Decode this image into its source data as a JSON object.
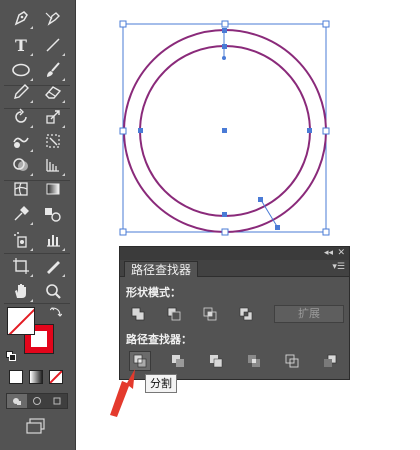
{
  "toolbar": {
    "tools": [
      {
        "icon": "pen-icon"
      },
      {
        "icon": "anchor-point-icon"
      },
      {
        "icon": "type-icon",
        "label": "T"
      },
      {
        "icon": "line-segment-icon"
      },
      {
        "icon": "ellipse-icon"
      },
      {
        "icon": "paintbrush-icon"
      },
      {
        "icon": "pencil-icon"
      },
      {
        "icon": "eraser-icon"
      },
      {
        "icon": "rotate-icon"
      },
      {
        "icon": "scale-icon"
      },
      {
        "icon": "warp-icon"
      },
      {
        "icon": "free-transform-icon"
      },
      {
        "icon": "shape-builder-icon"
      },
      {
        "icon": "perspective-grid-icon"
      },
      {
        "icon": "mesh-icon"
      },
      {
        "icon": "gradient-icon"
      },
      {
        "icon": "eyedropper-icon"
      },
      {
        "icon": "blend-icon"
      },
      {
        "icon": "symbol-sprayer-icon"
      },
      {
        "icon": "column-graph-icon"
      },
      {
        "icon": "artboard-icon"
      },
      {
        "icon": "slice-icon"
      },
      {
        "icon": "hand-icon"
      },
      {
        "icon": "zoom-icon"
      }
    ],
    "colors": {
      "fill": "none",
      "stroke": "#e3051b"
    }
  },
  "pathfinder": {
    "tab": "路径查找器",
    "shape_modes": {
      "label": "形状模式：",
      "buttons": [
        "unite-icon",
        "minus-front-icon",
        "intersect-icon",
        "exclude-icon"
      ],
      "expand_label": "扩展"
    },
    "pathfinders": {
      "label": "路径查找器：",
      "buttons": [
        "divide-icon",
        "trim-icon",
        "merge-icon",
        "crop-icon",
        "outline-icon",
        "minus-back-icon"
      ]
    },
    "tooltip": "分割"
  },
  "artwork": {
    "stroke_color": "#8a2a7a",
    "selection_color": "#4a7bd6"
  }
}
